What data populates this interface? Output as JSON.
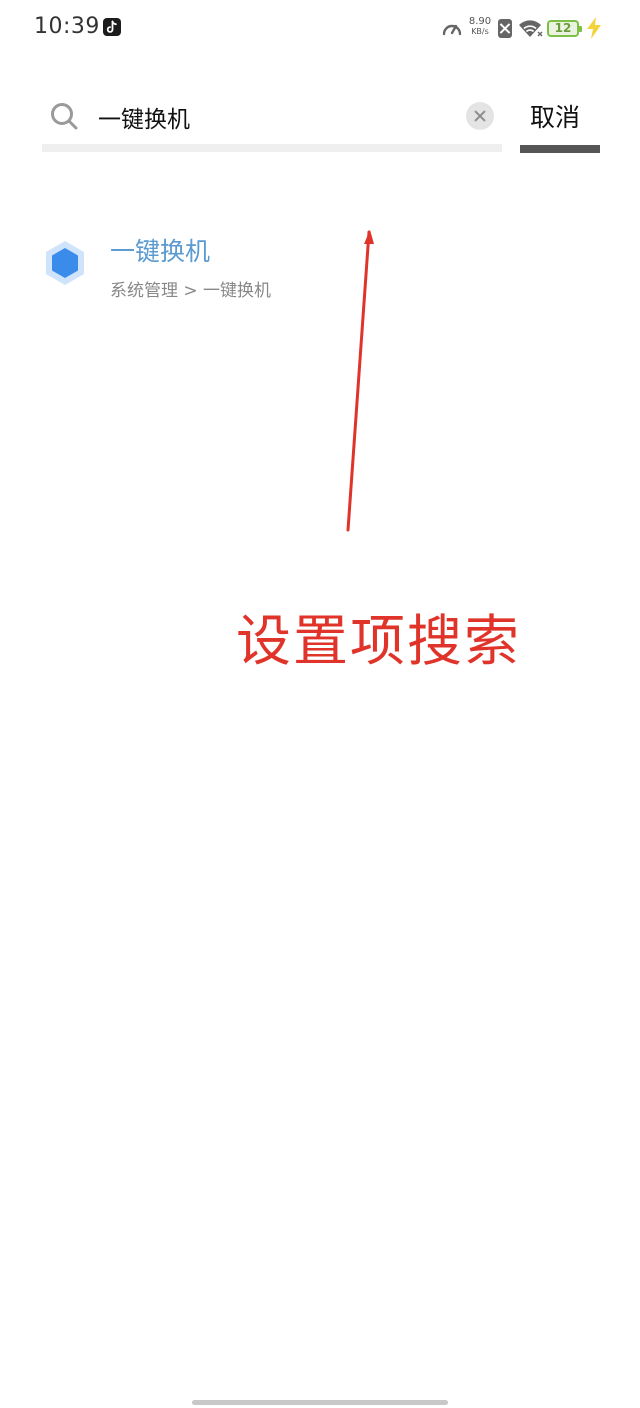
{
  "status_bar": {
    "time": "10:39",
    "app_icon": "tiktok-icon",
    "net_speed_value": "8.90",
    "net_speed_unit": "KB/s",
    "battery_level": "12",
    "icons": [
      "speedometer-icon",
      "sim-disabled-icon",
      "wifi-icon",
      "battery-icon",
      "charging-bolt-icon"
    ]
  },
  "search": {
    "query": "一键换机",
    "cancel_label": "取消"
  },
  "results": [
    {
      "icon": "hexagon-icon",
      "title": "一键换机",
      "path": "系统管理 > 一键换机"
    }
  ],
  "annotation": {
    "label": "设置项搜索",
    "color": "#e0342a"
  },
  "colors": {
    "result_title": "#5b9bd1",
    "result_icon": "#3b8bea",
    "battery": "#7dbf47",
    "bolt": "#f2d33c"
  }
}
